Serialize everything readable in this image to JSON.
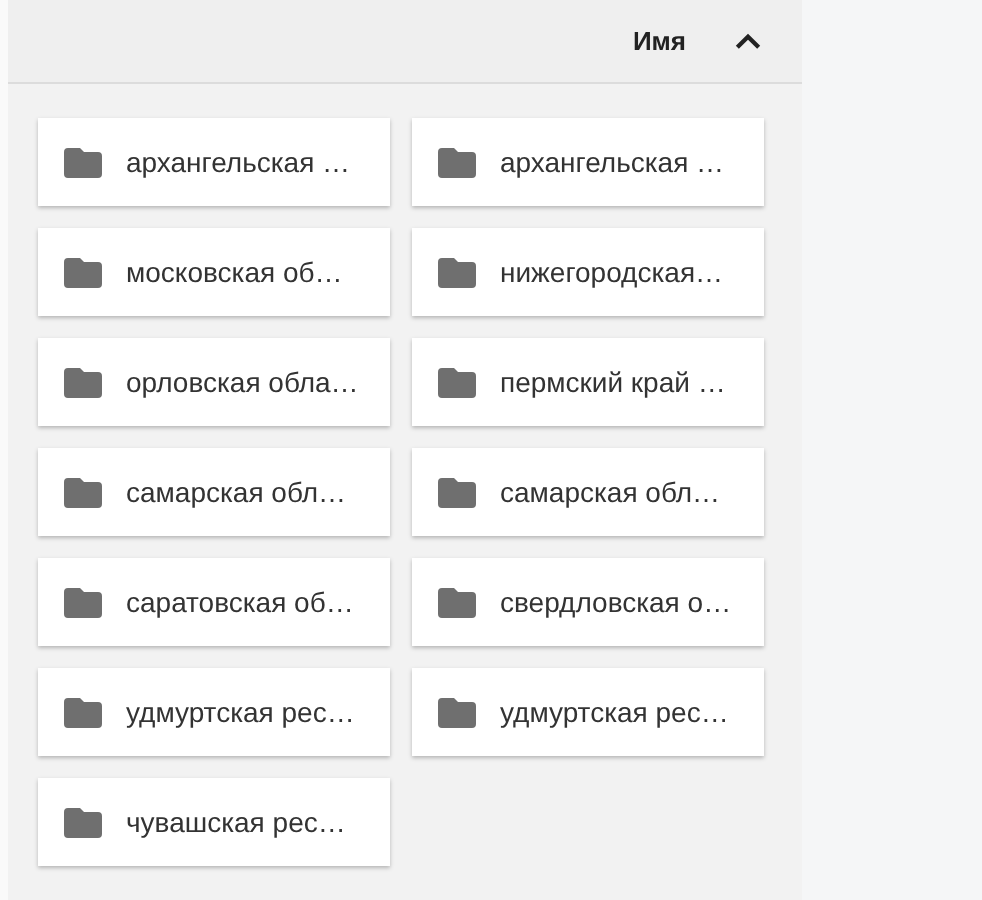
{
  "header": {
    "sort_label": "Имя",
    "sort_ascending": true
  },
  "folders": [
    {
      "name": "архангельская …"
    },
    {
      "name": "архангельская …"
    },
    {
      "name": "московская об…"
    },
    {
      "name": "нижегородская…"
    },
    {
      "name": "орловская обла…"
    },
    {
      "name": "пермский край …"
    },
    {
      "name": "самарская обл…"
    },
    {
      "name": "самарская обл…"
    },
    {
      "name": "саратовская об…"
    },
    {
      "name": "свердловская о…"
    },
    {
      "name": "удмуртская рес…"
    },
    {
      "name": "удмуртская рес…"
    },
    {
      "name": "чувашская рес…"
    }
  ]
}
